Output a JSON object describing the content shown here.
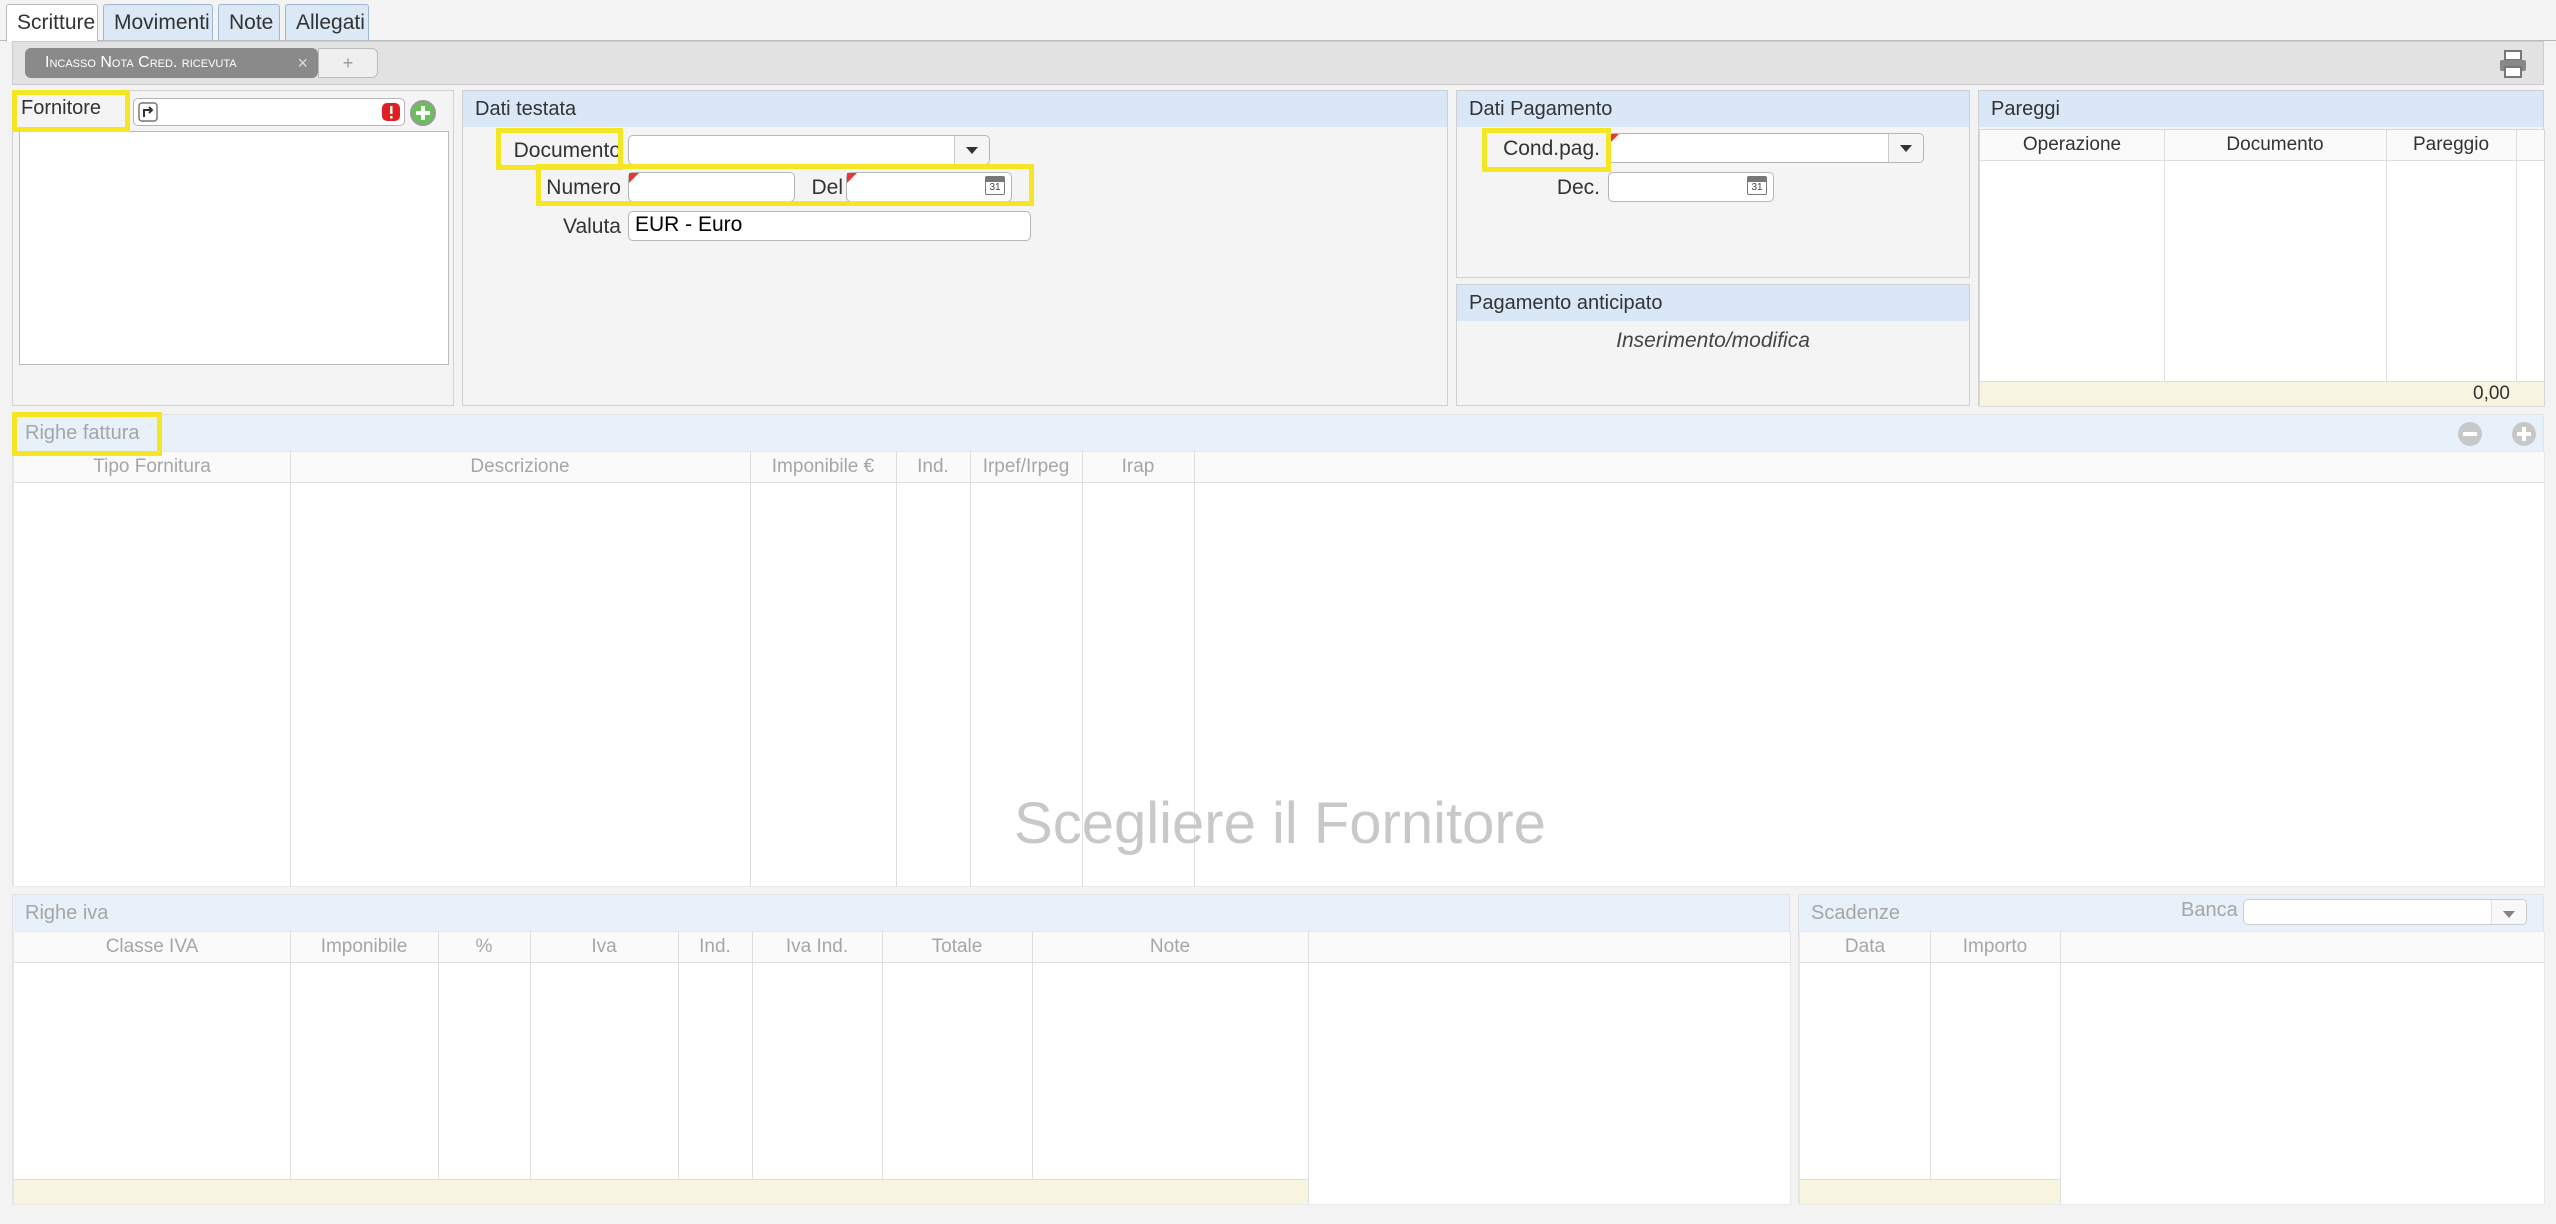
{
  "tabs": [
    "Scritture",
    "Movimenti",
    "Note",
    "Allegati"
  ],
  "doc_tab": {
    "label": "Incasso Nota Cred. ricevuta",
    "close": "×",
    "add": "+"
  },
  "fornitore": {
    "label": "Fornitore",
    "value": ""
  },
  "dati_testata": {
    "title": "Dati testata",
    "documento_label": "Documento",
    "documento_value": "",
    "numero_label": "Numero",
    "numero_value": "",
    "del_label": "Del",
    "del_value": "",
    "valuta_label": "Valuta",
    "valuta_value": "EUR - Euro"
  },
  "dati_pagamento": {
    "title": "Dati Pagamento",
    "cond_label": "Cond.pag.",
    "cond_value": "",
    "dec_label": "Dec.",
    "dec_value": ""
  },
  "pagamento_anticipato": {
    "title": "Pagamento anticipato",
    "link": "Inserimento/modifica"
  },
  "pareggi": {
    "title": "Pareggi",
    "columns": [
      "Operazione",
      "Documento",
      "Pareggio"
    ],
    "total": "0,00"
  },
  "righe_fattura": {
    "title": "Righe fattura",
    "columns": [
      "Tipo Fornitura",
      "Descrizione",
      "Imponibile €",
      "Ind.",
      "Irpef/Irpeg",
      "Irap"
    ],
    "placeholder": "Scegliere il Fornitore"
  },
  "righe_iva": {
    "title": "Righe iva",
    "columns": [
      "Classe IVA",
      "Imponibile",
      "%",
      "Iva",
      "Ind.",
      "Iva Ind.",
      "Totale",
      "Note"
    ]
  },
  "scadenze": {
    "title": "Scadenze",
    "banca_label": "Banca",
    "banca_value": "",
    "columns": [
      "Data",
      "Importo"
    ]
  },
  "colors": {
    "accent": "#f5e624",
    "header": "#d9e7f7",
    "footer": "#f7f4e0"
  }
}
